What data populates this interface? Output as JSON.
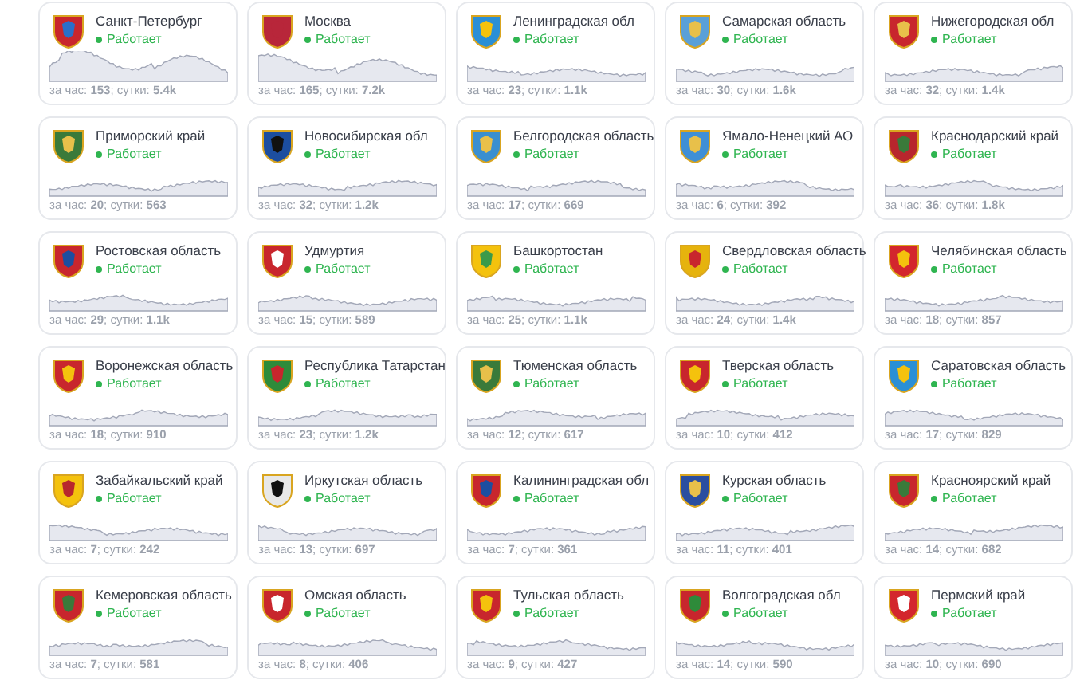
{
  "regions": [
    {
      "name": "Санкт-Петербург",
      "status": "Работает",
      "stats": "за час: **153**; сутки: **5.4k**"
    },
    {
      "name": "Москва",
      "status": "Работает",
      "stats": "за час: **165**; сутки: **7.2k**"
    },
    {
      "name": "Ленинградская обл",
      "status": "Работает",
      "stats": "за час: **23**; сутки: **1.1k**"
    },
    {
      "name": "Самарская область",
      "status": "Работает",
      "stats": "за час: **30**; сутки: **1.6k**"
    },
    {
      "name": "Нижегородская обл",
      "status": "Работает",
      "stats": "за час: **32**; сутки: **1.4k**"
    },
    {
      "name": "Приморский край",
      "status": "Работает",
      "stats": "за час: **20**; сутки: **563**"
    },
    {
      "name": "Новосибирская обл",
      "status": "Работает",
      "stats": "за час: **32**; сутки: **1.2k**"
    },
    {
      "name": "Белгородская область",
      "status": "Работает",
      "stats": "за час: **17**; сутки: **669**"
    },
    {
      "name": "Ямало-Ненецкий АО",
      "status": "Работает",
      "stats": "за час: **6**; сутки: **392**"
    },
    {
      "name": "Краснодарский край",
      "status": "Работает",
      "stats": "за час: **36**; сутки: **1.8k**"
    },
    {
      "name": "Ростовская область",
      "status": "Работает",
      "stats": "за час: **29**; сутки: **1.1k**"
    },
    {
      "name": "Удмуртия",
      "status": "Работает",
      "stats": "за час: **15**; сутки: **589**"
    },
    {
      "name": "Башкортостан",
      "status": "Работает",
      "stats": "за час: **25**; сутки: **1.1k**"
    },
    {
      "name": "Свердловская область",
      "status": "Работает",
      "stats": "за час: **24**; сутки: **1.4k**"
    },
    {
      "name": "Челябинская область",
      "status": "Работает",
      "stats": "за час: **18**; сутки: **857**"
    },
    {
      "name": "Воронежская область",
      "status": "Работает",
      "stats": "за час: **18**; сутки: **910**"
    },
    {
      "name": "Республика Татарстан",
      "status": "Работает",
      "stats": "за час: **23**; сутки: **1.2k**"
    },
    {
      "name": "Тюменская область",
      "status": "Работает",
      "stats": "за час: **12**; сутки: **617**"
    },
    {
      "name": "Тверская область",
      "status": "Работает",
      "stats": "за час: **10**; сутки: **412**"
    },
    {
      "name": "Саратовская область",
      "status": "Работает",
      "stats": "за час: **17**; сутки: **829**"
    },
    {
      "name": "Забайкальский край",
      "status": "Работает",
      "stats": "за час: **7**; сутки: **242**"
    },
    {
      "name": "Иркутская область",
      "status": "Работает",
      "stats": "за час: **13**; сутки: **697**"
    },
    {
      "name": "Калининградская обл",
      "status": "Работает",
      "stats": "за час: **7**; сутки: **361**"
    },
    {
      "name": "Курская область",
      "status": "Работает",
      "stats": "за час: **11**; сутки: **401**"
    },
    {
      "name": "Красноярский край",
      "status": "Работает",
      "stats": "за час: **14**; сутки: **682**"
    },
    {
      "name": "Кемеровская область",
      "status": "Работает",
      "stats": "за час: **7**; сутки: **581**"
    },
    {
      "name": "Омская область",
      "status": "Работает",
      "stats": "за час: **8**; сутки: **406**"
    },
    {
      "name": "Тульская область",
      "status": "Работает",
      "stats": "за час: **9**; сутки: **427**"
    },
    {
      "name": "Волгоградская обл",
      "status": "Работает",
      "stats": "за час: **14**; сутки: **590**"
    },
    {
      "name": "Пермский край",
      "status": "Работает",
      "stats": "за час: **10**; сутки: **690**"
    }
  ]
}
